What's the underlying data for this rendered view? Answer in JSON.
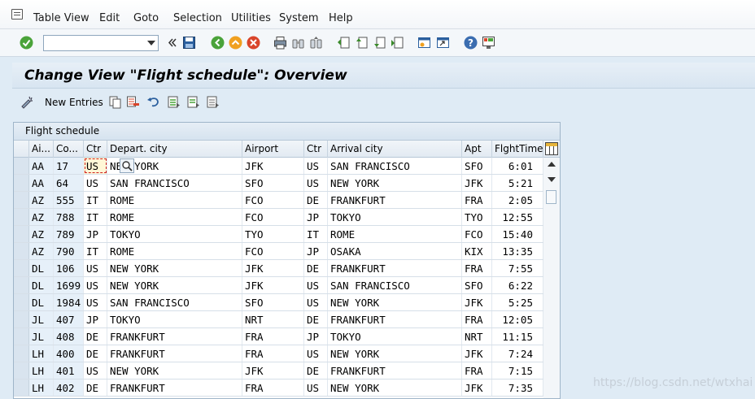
{
  "menu": [
    "Table View",
    "Edit",
    "Goto",
    "Selection",
    "Utilities",
    "System",
    "Help"
  ],
  "toolbar": {
    "command_value": ""
  },
  "title": "Change View \"Flight schedule\": Overview",
  "app_toolbar": {
    "new_entries_label": "New Entries"
  },
  "table": {
    "caption": "Flight schedule",
    "headers": [
      "Ai...",
      "Co...",
      "Ctr",
      "Depart. city",
      "Airport",
      "Ctr",
      "Arrival city",
      "Apt",
      "FlghtTime"
    ],
    "rows": [
      [
        "AA",
        "17",
        "US",
        "NEW YORK",
        "JFK",
        "US",
        "SAN FRANCISCO",
        "SFO",
        "6:01"
      ],
      [
        "AA",
        "64",
        "US",
        "SAN FRANCISCO",
        "SFO",
        "US",
        "NEW YORK",
        "JFK",
        "5:21"
      ],
      [
        "AZ",
        "555",
        "IT",
        "ROME",
        "FCO",
        "DE",
        "FRANKFURT",
        "FRA",
        "2:05"
      ],
      [
        "AZ",
        "788",
        "IT",
        "ROME",
        "FCO",
        "JP",
        "TOKYO",
        "TYO",
        "12:55"
      ],
      [
        "AZ",
        "789",
        "JP",
        "TOKYO",
        "TYO",
        "IT",
        "ROME",
        "FCO",
        "15:40"
      ],
      [
        "AZ",
        "790",
        "IT",
        "ROME",
        "FCO",
        "JP",
        "OSAKA",
        "KIX",
        "13:35"
      ],
      [
        "DL",
        "106",
        "US",
        "NEW YORK",
        "JFK",
        "DE",
        "FRANKFURT",
        "FRA",
        "7:55"
      ],
      [
        "DL",
        "1699",
        "US",
        "NEW YORK",
        "JFK",
        "US",
        "SAN FRANCISCO",
        "SFO",
        "6:22"
      ],
      [
        "DL",
        "1984",
        "US",
        "SAN FRANCISCO",
        "SFO",
        "US",
        "NEW YORK",
        "JFK",
        "5:25"
      ],
      [
        "JL",
        "407",
        "JP",
        "TOKYO",
        "NRT",
        "DE",
        "FRANKFURT",
        "FRA",
        "12:05"
      ],
      [
        "JL",
        "408",
        "DE",
        "FRANKFURT",
        "FRA",
        "JP",
        "TOKYO",
        "NRT",
        "11:15"
      ],
      [
        "LH",
        "400",
        "DE",
        "FRANKFURT",
        "FRA",
        "US",
        "NEW YORK",
        "JFK",
        "7:24"
      ],
      [
        "LH",
        "401",
        "US",
        "NEW YORK",
        "JFK",
        "DE",
        "FRANKFURT",
        "FRA",
        "7:15"
      ],
      [
        "LH",
        "402",
        "DE",
        "FRANKFURT",
        "FRA",
        "US",
        "NEW YORK",
        "JFK",
        "7:35"
      ]
    ]
  },
  "watermark": "https://blog.csdn.net/wtxhai"
}
